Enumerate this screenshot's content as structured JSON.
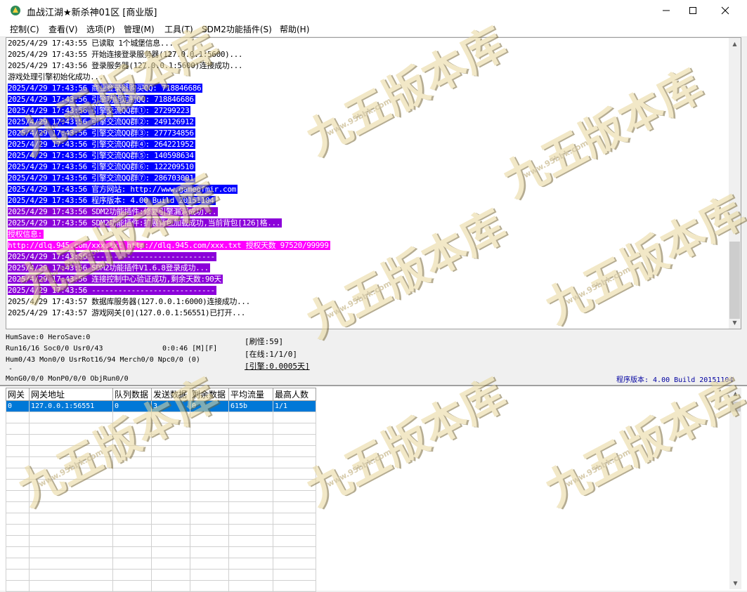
{
  "window": {
    "title": "血战江湖★新杀神01区 [商业版]"
  },
  "menu": [
    "控制(C)",
    "查看(V)",
    "选项(P)",
    "管理(M)",
    "工具(T)",
    "SDM2功能插件(S)",
    "帮助(H)"
  ],
  "log": [
    {
      "text": "2025/4/29 17:43:55 已读取 1个城堡信息...",
      "hl": ""
    },
    {
      "text": "2025/4/29 17:43:55 开始连接登录服务器(127.0.0.1:5600)...",
      "hl": ""
    },
    {
      "text": "2025/4/29 17:43:56 登录服务器(127.0.0.1:5600)连接成功...",
      "hl": ""
    },
    {
      "text": "游戏处理引擎初始化成功...",
      "hl": ""
    },
    {
      "text": "2025/4/29 17:43:56 商业登录器购买QQ: 718846686",
      "hl": "blue"
    },
    {
      "text": "2025/4/29 17:43:56 引擎功能定制QQ: 718846686",
      "hl": "blue"
    },
    {
      "text": "2025/4/29 17:43:56 引擎交流QQ群①: 27299223",
      "hl": "blue"
    },
    {
      "text": "2025/4/29 17:43:56 引擎交流QQ群②: 249126912",
      "hl": "blue"
    },
    {
      "text": "2025/4/29 17:43:56 引擎交流QQ群③: 277734856",
      "hl": "blue"
    },
    {
      "text": "2025/4/29 17:43:56 引擎交流QQ群④: 264221952",
      "hl": "blue"
    },
    {
      "text": "2025/4/29 17:43:56 引擎交流QQ群⑤: 140598634",
      "hl": "blue"
    },
    {
      "text": "2025/4/29 17:43:56 引擎交流QQ群⑥: 122209510",
      "hl": "blue"
    },
    {
      "text": "2025/4/29 17:43:56 引擎交流QQ群⑦: 286703001",
      "hl": "blue"
    },
    {
      "text": "2025/4/29 17:43:56 官方网站: http://www.gameofmir.com",
      "hl": "blue"
    },
    {
      "text": "2025/4/29 17:43:56 程序版本: 4.00 Build 20151104",
      "hl": "blue"
    },
    {
      "text": "2025/4/29 17:43:56 SDM2功能插件:修复引擎漏洞成功...",
      "hl": "purple"
    },
    {
      "text": "2025/4/29 17:43:56 SDM2功能插件:扩展背包加载成功,当前背包[126]格...",
      "hl": "purple"
    },
    {
      "text": "授权信息:",
      "hl": "magenta"
    },
    {
      "text": "http://dlq.945.com/xxx.txt http://dlq.945.com/xxx.txt 授权天数 97520/99999",
      "hl": "magenta"
    },
    {
      "text": "2025/4/29 17:43:56 ----------------------------",
      "hl": "purple"
    },
    {
      "text": "2025/4/29 17:43:56 SDM2功能插件V1.6.8登录成功...",
      "hl": "purple"
    },
    {
      "text": "2025/4/29 17:43:56 连接控制中心验证成功,剩余天数:90天",
      "hl": "purple"
    },
    {
      "text": "2025/4/29 17:43:56 ----------------------------",
      "hl": "purple"
    },
    {
      "text": "2025/4/29 17:43:57 数据库服务器(127.0.0.1:6000)连接成功...",
      "hl": ""
    },
    {
      "text": "2025/4/29 17:43:57 游戏网关[0](127.0.0.1:56551)已打开...",
      "hl": ""
    }
  ],
  "status": {
    "line1": "HumSave:0 HeroSave:0",
    "line2": "Run16/16 Soc0/0 Usr0/43",
    "timer": "0:0:46 [M][F]",
    "line3": "Hum0/43 Mon0/0 UsrRot16/94 Merch0/0 Npc0/0 (0)",
    "dash": "-",
    "line4": "MonG0/0/0 MonP0/0/0 ObjRun0/0",
    "refresh_monster": "[刷怪:59]",
    "online": "[在线:1/1/0]",
    "engine": "[引擎:0.0005天]",
    "version": "程序版本: 4.00 Build 20151104"
  },
  "gateway_table": {
    "headers": [
      "网关",
      "网关地址",
      "队列数据",
      "发送数据",
      "剩余数据",
      "平均流量",
      "最高人数"
    ],
    "rows": [
      [
        "0",
        "127.0.0.1:56551",
        "0",
        "3",
        "0",
        "615b",
        "1/1"
      ]
    ]
  },
  "watermark": {
    "text": "九五版本库",
    "url": "www.95bbk.com"
  },
  "colors": {
    "hl_blue": "#0000ff",
    "hl_purple": "#8b00d9",
    "hl_magenta": "#ff00ff",
    "selection": "#0078d7"
  }
}
